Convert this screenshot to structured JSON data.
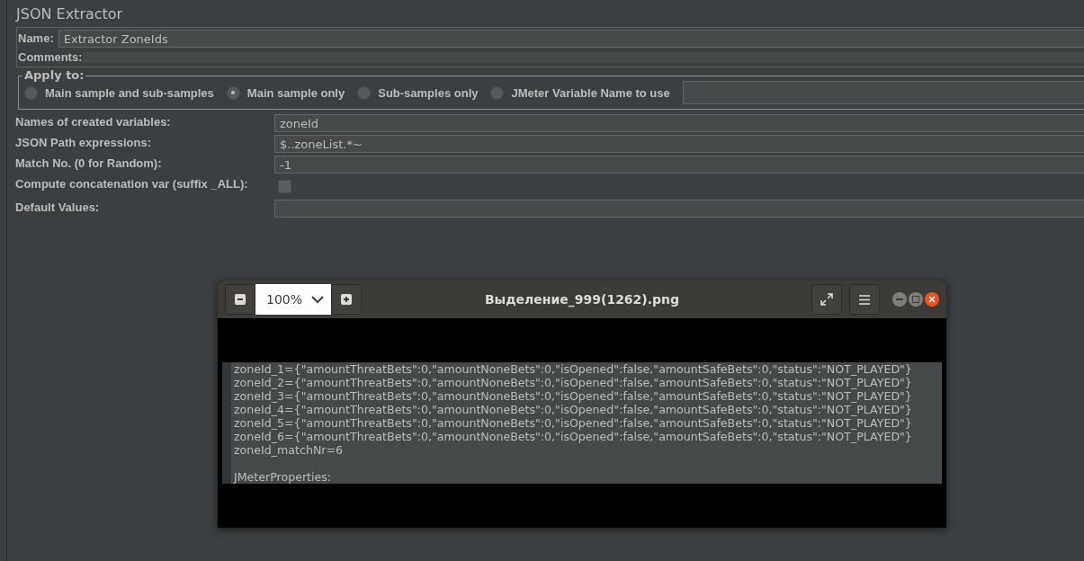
{
  "panel": {
    "title": "JSON Extractor",
    "name": {
      "label": "Name:",
      "value": "Extractor ZoneIds"
    },
    "comments": {
      "label": "Comments:"
    },
    "apply_to": {
      "legend": "Apply to:",
      "options": [
        {
          "label": "Main sample and sub-samples",
          "selected": false
        },
        {
          "label": "Main sample only",
          "selected": true
        },
        {
          "label": "Sub-samples only",
          "selected": false
        },
        {
          "label": "JMeter Variable Name to use",
          "selected": false
        }
      ]
    },
    "fields": [
      {
        "kind": "text",
        "label": "Names of created variables:",
        "value": "zoneId"
      },
      {
        "kind": "text",
        "label": "JSON Path expressions:",
        "value": "$..zoneList.*~"
      },
      {
        "kind": "text",
        "label": "Match No. (0 for Random):",
        "value": "-1"
      },
      {
        "kind": "checkbox",
        "label": "Compute concatenation var (suffix _ALL):",
        "checked": false
      },
      {
        "kind": "text",
        "label": "Default Values:"
      }
    ]
  },
  "viewer": {
    "zoom": "100%",
    "title": "Выделение_999(1262).png",
    "lines": [
      "zoneId_1={\"amountThreatBets\":0,\"amountNoneBets\":0,\"isOpened\":false,\"amountSafeBets\":0,\"status\":\"NOT_PLAYED\"}",
      "zoneId_2={\"amountThreatBets\":0,\"amountNoneBets\":0,\"isOpened\":false,\"amountSafeBets\":0,\"status\":\"NOT_PLAYED\"}",
      "zoneId_3={\"amountThreatBets\":0,\"amountNoneBets\":0,\"isOpened\":false,\"amountSafeBets\":0,\"status\":\"NOT_PLAYED\"}",
      "zoneId_4={\"amountThreatBets\":0,\"amountNoneBets\":0,\"isOpened\":false,\"amountSafeBets\":0,\"status\":\"NOT_PLAYED\"}",
      "zoneId_5={\"amountThreatBets\":0,\"amountNoneBets\":0,\"isOpened\":false,\"amountSafeBets\":0,\"status\":\"NOT_PLAYED\"}",
      "zoneId_6={\"amountThreatBets\":0,\"amountNoneBets\":0,\"isOpened\":false,\"amountSafeBets\":0,\"status\":\"NOT_PLAYED\"}",
      "zoneId_matchNr=6"
    ],
    "footer": "JMeterProperties:"
  }
}
